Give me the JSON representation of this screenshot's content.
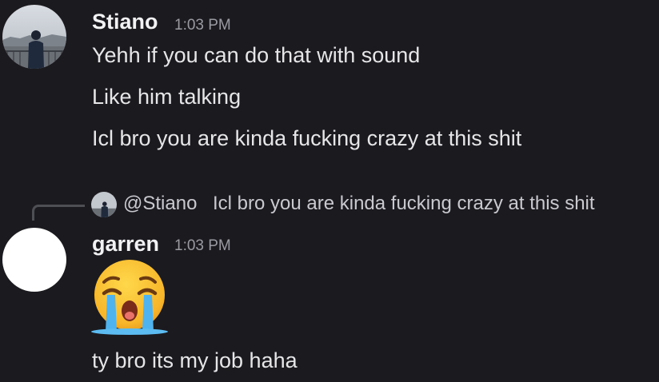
{
  "messages": [
    {
      "author": "Stiano",
      "time": "1:03 PM",
      "lines": [
        "Yehh if you can do that with sound",
        "Like him talking",
        "Icl bro you are kinda fucking crazy at this shit"
      ]
    },
    {
      "author": "garren",
      "time": "1:03 PM",
      "reply": {
        "mention": "@Stiano",
        "text": "Icl bro you are kinda fucking crazy at this shit"
      },
      "emoji": "loudly-crying-face-emoji",
      "lines": [
        "ty bro its my job haha"
      ]
    }
  ],
  "colors": {
    "background": "#1b1a1f",
    "username": "#f2f2f4",
    "timestamp": "#9a9aa3",
    "text": "#e6e6e8"
  }
}
